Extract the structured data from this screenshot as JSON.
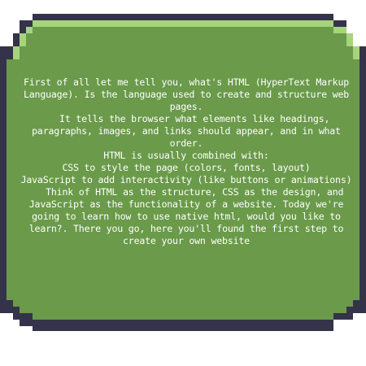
{
  "frame": {
    "colors": {
      "outline": "#34334a",
      "fill": "#6a9a4a",
      "highlight": "#a6d47a",
      "text": "#ffffff",
      "background": "#ffffff"
    }
  },
  "content": {
    "lines": [
      "First of all let me tell you, what's HTML (HyperText Markup Language). Is the language used to create and structure web pages.",
      "   It tells the browser what elements like headings, paragraphs, images, and links should appear, and in what order.",
      "HTML is usually combined with:",
      "CSS to style the page (colors, fonts, layout)",
      "JavaScript to add interactivity (like buttons or animations)",
      "   Think of HTML as the structure, CSS as the design, and JavaScript as the functionality of a website. Today we're going to learn how to use native html, would you like to learn?. There you go, here you'll found the first step to create your own website"
    ]
  }
}
